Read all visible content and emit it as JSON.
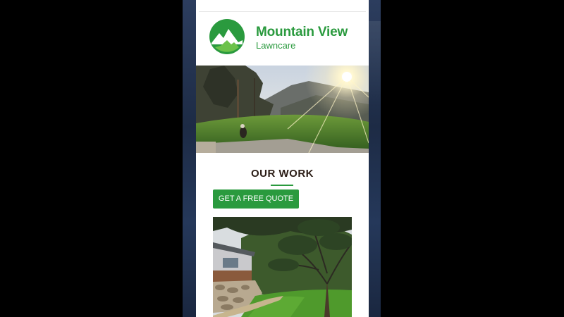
{
  "brand": {
    "name": "Mountain View",
    "subtitle": "Lawncare",
    "color": "#2a9a3e",
    "logo_icon": "mountain-logo-icon"
  },
  "hero": {
    "image": "backyard-sunset-photo"
  },
  "work": {
    "title": "OUR WORK",
    "cta_label": "GET A FREE QUOTE",
    "photo": "landscaped-yard-photo"
  },
  "colors": {
    "accent": "#2a9a3e",
    "title_text": "#2b1d16",
    "side_background": "#1d2b45"
  }
}
